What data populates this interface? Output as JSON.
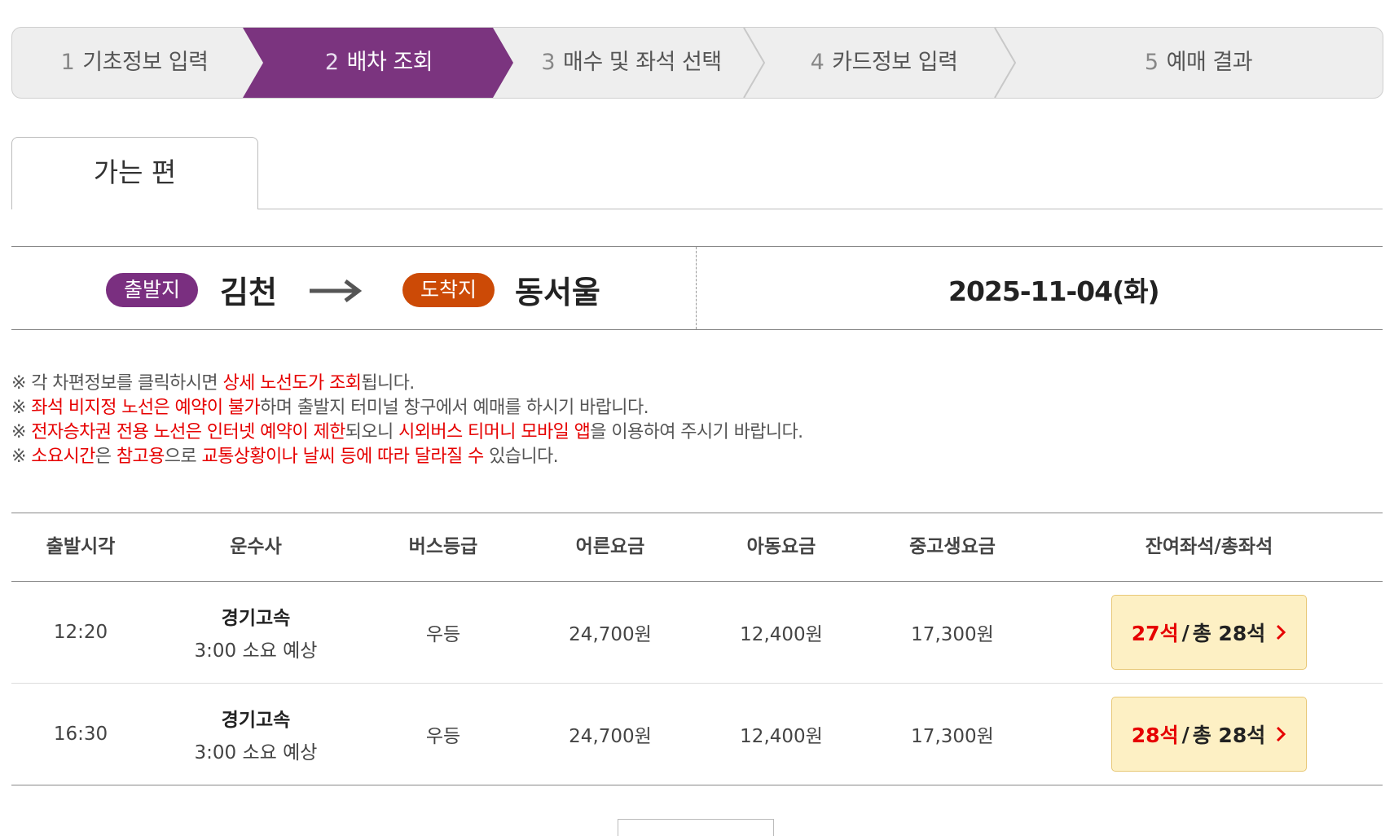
{
  "steps": [
    {
      "num": "1",
      "label": "기초정보 입력"
    },
    {
      "num": "2",
      "label": "배차 조회"
    },
    {
      "num": "3",
      "label": "매수 및 좌석 선택"
    },
    {
      "num": "4",
      "label": "카드정보 입력"
    },
    {
      "num": "5",
      "label": "예매 결과"
    }
  ],
  "active_step_color": "#7b347f",
  "tab": {
    "label": "가는 편"
  },
  "route": {
    "departure_label": "출발지",
    "departure_city": "김천",
    "arrival_label": "도착지",
    "arrival_city": "동서울",
    "date": "2025-11-04(화)",
    "departure_color": "#7a2f80",
    "arrival_color": "#cc4a06"
  },
  "notices": [
    {
      "prefix": "※ ",
      "parts": [
        {
          "text": "각 차편정보를 클릭하시면 ",
          "red": false
        },
        {
          "text": "상세 노선도가 조회",
          "red": true
        },
        {
          "text": "됩니다.",
          "red": false
        }
      ]
    },
    {
      "prefix": "※ ",
      "parts": [
        {
          "text": "좌석 비지정 노선은 예약이 불가",
          "red": true
        },
        {
          "text": "하며 출발지 터미널 창구에서 예매를 하시기 바랍니다.",
          "red": false
        }
      ]
    },
    {
      "prefix": "※ ",
      "parts": [
        {
          "text": "전자승차권 전용 노선은 인터넷 예약이 제한",
          "red": true
        },
        {
          "text": "되오니 ",
          "red": false
        },
        {
          "text": "시외버스 티머니 모바일 앱",
          "red": true
        },
        {
          "text": "을 이용하여 주시기 바랍니다.",
          "red": false
        }
      ]
    },
    {
      "prefix": "※ ",
      "parts": [
        {
          "text": "소요시간",
          "red": true
        },
        {
          "text": "은 ",
          "red": false
        },
        {
          "text": "참고용",
          "red": true
        },
        {
          "text": "으로 ",
          "red": false
        },
        {
          "text": "교통상황이나 날씨 등에 따라 달라질 수",
          "red": true
        },
        {
          "text": " 있습니다.",
          "red": false
        }
      ]
    }
  ],
  "table": {
    "headers": [
      "출발시각",
      "운수사",
      "버스등급",
      "어른요금",
      "아동요금",
      "중고생요금",
      "잔여좌석/총좌석"
    ],
    "rows": [
      {
        "time": "12:20",
        "company": "경기고속",
        "duration": "3:00 소요 예상",
        "grade": "우등",
        "adult": "24,700원",
        "child": "12,400원",
        "youth": "17,300원",
        "remain": "27석",
        "sep": "/",
        "total": "총 28석"
      },
      {
        "time": "16:30",
        "company": "경기고속",
        "duration": "3:00 소요 예상",
        "grade": "우등",
        "adult": "24,700원",
        "child": "12,400원",
        "youth": "17,300원",
        "remain": "28석",
        "sep": "/",
        "total": "총 28석"
      }
    ]
  }
}
